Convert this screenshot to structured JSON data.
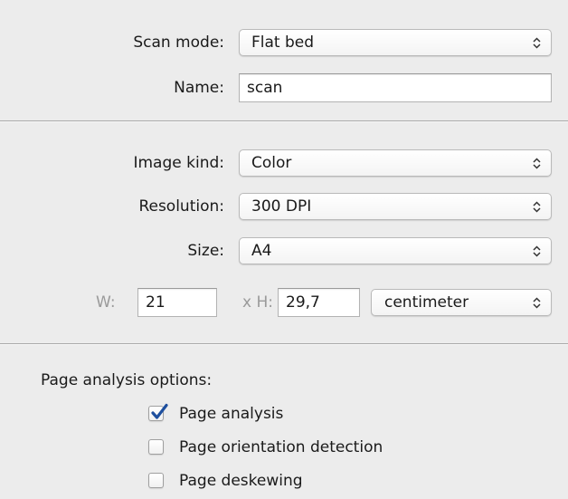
{
  "scan": {
    "mode_label": "Scan mode:",
    "mode_value": "Flat bed",
    "name_label": "Name:",
    "name_value": "scan"
  },
  "image": {
    "kind_label": "Image kind:",
    "kind_value": "Color",
    "resolution_label": "Resolution:",
    "resolution_value": "300 DPI",
    "size_label": "Size:",
    "size_value": "A4",
    "width_label": "W:",
    "width_value": "21",
    "height_label": "x H:",
    "height_value": "29,7",
    "unit_value": "centimeter"
  },
  "page_analysis": {
    "title": "Page analysis options:",
    "options": [
      {
        "label": "Page analysis",
        "checked": true
      },
      {
        "label": "Page orientation detection",
        "checked": false
      },
      {
        "label": "Page deskewing",
        "checked": false
      }
    ]
  },
  "icons": {
    "select_arrows": "up-down-chevron-icon",
    "checkmark": "checkmark-icon"
  },
  "colors": {
    "background": "#ececec",
    "checkmark": "#1e4f9e",
    "dimmed_label": "#9a9a9a"
  }
}
